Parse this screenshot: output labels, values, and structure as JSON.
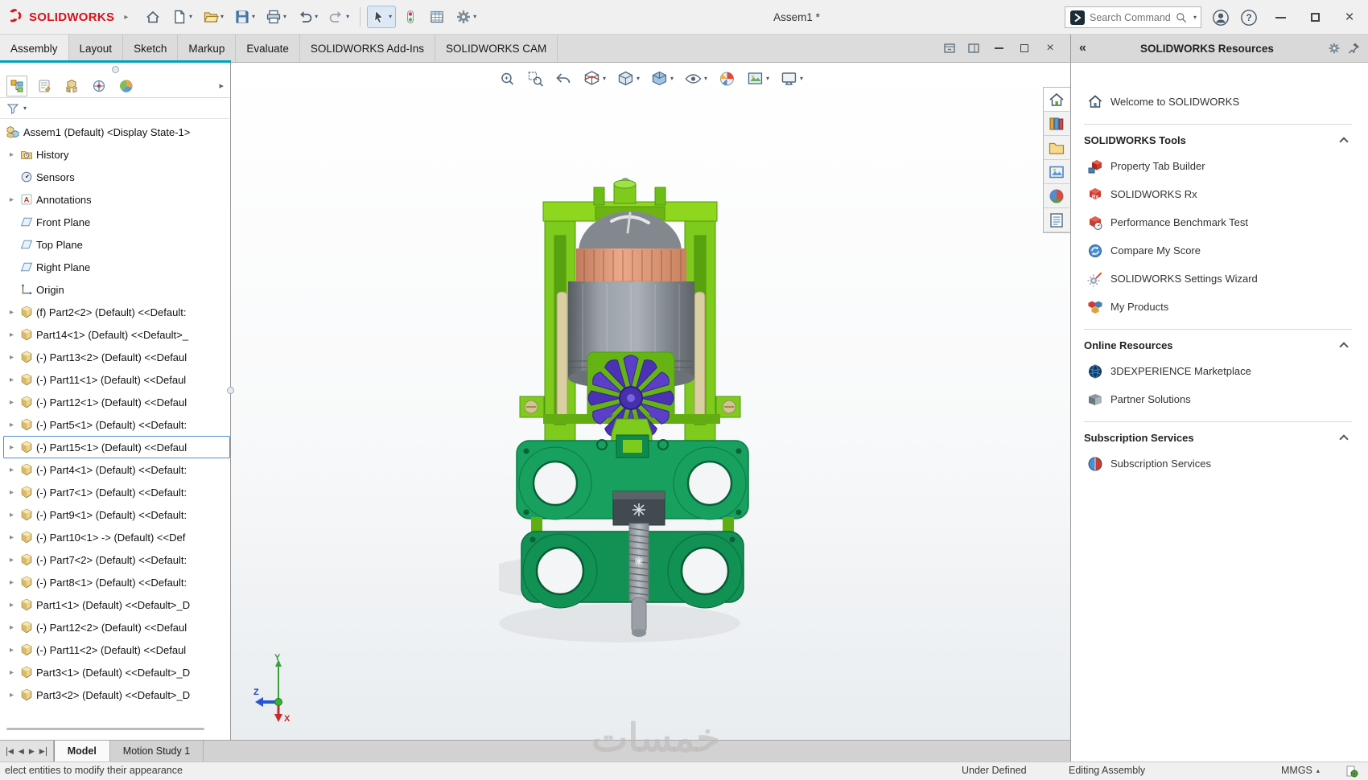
{
  "titlebar": {
    "brand": "SOLIDWORKS",
    "doc_title": "Assem1 *",
    "search_placeholder": "Search Commands",
    "tools": [
      {
        "icon": "home"
      },
      {
        "icon": "new-document",
        "caret": true
      },
      {
        "icon": "open-folder",
        "caret": true
      },
      {
        "icon": "save",
        "caret": true
      },
      {
        "icon": "print",
        "caret": true
      },
      {
        "icon": "undo",
        "caret": true
      },
      {
        "icon": "redo",
        "caret": true
      },
      {
        "type": "sep"
      },
      {
        "icon": "select-cursor",
        "caret": true,
        "pressed": true
      },
      {
        "icon": "selection-toggle"
      },
      {
        "icon": "evaluate-table"
      },
      {
        "icon": "options-gear",
        "caret": true
      }
    ]
  },
  "glyphs": {
    "caret_down": "▾",
    "caret_up": "▴",
    "expand_arrow": "▸",
    "collapse_left": "«"
  },
  "ribbon": {
    "tabs": [
      "Assembly",
      "Layout",
      "Sketch",
      "Markup",
      "Evaluate",
      "SOLIDWORKS Add-Ins",
      "SOLIDWORKS CAM"
    ],
    "active_tab": "Assembly"
  },
  "feature_tree": {
    "manager_tabs": [
      "featuremanager",
      "propertymanager",
      "configurationmanager",
      "dimxpert",
      "displaymanager"
    ],
    "root_label": "Assem1 (Default) <Display State-1>",
    "items": [
      {
        "label": "History",
        "icon": "history",
        "arrow": true
      },
      {
        "label": "Sensors",
        "icon": "sensors",
        "arrow": false
      },
      {
        "label": "Annotations",
        "icon": "annotations",
        "arrow": true
      },
      {
        "label": "Front Plane",
        "icon": "plane",
        "arrow": false
      },
      {
        "label": "Top Plane",
        "icon": "plane",
        "arrow": false
      },
      {
        "label": "Right Plane",
        "icon": "plane",
        "arrow": false
      },
      {
        "label": "Origin",
        "icon": "origin",
        "arrow": false
      },
      {
        "label": "(f) Part2<2> (Default) <<Default:",
        "icon": "part",
        "arrow": true
      },
      {
        "label": "Part14<1> (Default) <<Default>_",
        "icon": "part",
        "arrow": true
      },
      {
        "label": "(-) Part13<2> (Default) <<Defaul",
        "icon": "part",
        "arrow": true
      },
      {
        "label": "(-) Part11<1> (Default) <<Defaul",
        "icon": "part",
        "arrow": true
      },
      {
        "label": "(-) Part12<1> (Default) <<Defaul",
        "icon": "part",
        "arrow": true
      },
      {
        "label": "(-) Part5<1> (Default) <<Default:",
        "icon": "part",
        "arrow": true
      },
      {
        "label": "(-) Part15<1> (Default) <<Defaul",
        "icon": "part",
        "arrow": true,
        "selected": true
      },
      {
        "label": "(-) Part4<1> (Default) <<Default:",
        "icon": "part",
        "arrow": true
      },
      {
        "label": "(-) Part7<1> (Default) <<Default:",
        "icon": "part",
        "arrow": true
      },
      {
        "label": "(-) Part9<1> (Default) <<Default:",
        "icon": "part",
        "arrow": true
      },
      {
        "label": "(-) Part10<1> -> (Default) <<Def",
        "icon": "part",
        "arrow": true
      },
      {
        "label": "(-) Part7<2> (Default) <<Default:",
        "icon": "part",
        "arrow": true
      },
      {
        "label": "(-) Part8<1> (Default) <<Default:",
        "icon": "part",
        "arrow": true
      },
      {
        "label": "Part1<1> (Default) <<Default>_D",
        "icon": "part",
        "arrow": true
      },
      {
        "label": "(-) Part12<2> (Default) <<Defaul",
        "icon": "part",
        "arrow": true
      },
      {
        "label": "(-) Part11<2> (Default) <<Defaul",
        "icon": "part",
        "arrow": true
      },
      {
        "label": "Part3<1> (Default) <<Default>_D",
        "icon": "part",
        "arrow": true
      },
      {
        "label": "Part3<2> (Default) <<Default>_D",
        "icon": "part",
        "arrow": true
      }
    ]
  },
  "viewport": {
    "watermark": "خمسات",
    "headsup": [
      {
        "icon": "zoom-to-fit"
      },
      {
        "icon": "zoom-to-area"
      },
      {
        "icon": "previous-view"
      },
      {
        "icon": "section-view",
        "caret": true
      },
      {
        "icon": "view-orientation",
        "caret": true
      },
      {
        "icon": "display-style",
        "caret": true
      },
      {
        "icon": "hide-show-items",
        "caret": true
      },
      {
        "icon": "edit-appearance"
      },
      {
        "icon": "apply-scene",
        "caret": true
      },
      {
        "icon": "view-settings",
        "caret": true
      }
    ]
  },
  "taskpane": {
    "title": "SOLIDWORKS Resources",
    "welcome": "Welcome to SOLIDWORKS",
    "tab_icons": [
      "resources-home",
      "design-library",
      "file-explorer",
      "view-palette",
      "appearances-scenes",
      "custom-properties"
    ],
    "sections": [
      {
        "title": "SOLIDWORKS Tools",
        "items": [
          {
            "label": "Property Tab Builder",
            "icon": "property-tab-builder"
          },
          {
            "label": "SOLIDWORKS Rx",
            "icon": "rx"
          },
          {
            "label": "Performance Benchmark Test",
            "icon": "benchmark"
          },
          {
            "label": "Compare My Score",
            "icon": "compare"
          },
          {
            "label": "SOLIDWORKS Settings Wizard",
            "icon": "wizard"
          },
          {
            "label": "My Products",
            "icon": "products"
          }
        ]
      },
      {
        "title": "Online Resources",
        "items": [
          {
            "label": "3DEXPERIENCE Marketplace",
            "icon": "marketplace"
          },
          {
            "label": "Partner Solutions",
            "icon": "partner"
          }
        ]
      },
      {
        "title": "Subscription Services",
        "items": [
          {
            "label": "Subscription Services",
            "icon": "subscription"
          }
        ]
      }
    ]
  },
  "model_tabs": {
    "nav": [
      "◀",
      "◀",
      "▶",
      "▶"
    ],
    "tabs": [
      {
        "label": "Model",
        "active": true
      },
      {
        "label": "Motion Study 1",
        "active": false
      }
    ]
  },
  "statusbar": {
    "message": "elect entities to modify their appearance",
    "constraint_status": "Under Defined",
    "mode": "Editing Assembly",
    "units": "MMGS"
  },
  "colors": {
    "accent_teal": "#00a3bb",
    "brand_red": "#d6151c",
    "lime_green": "#7ecb1e",
    "dark_green": "#17a05e",
    "purple": "#5b3fc8",
    "salmon": "#df9a7c",
    "steel_gray": "#858b91",
    "tan": "#d9cfa2",
    "selection_blue": "#4a90d9"
  }
}
